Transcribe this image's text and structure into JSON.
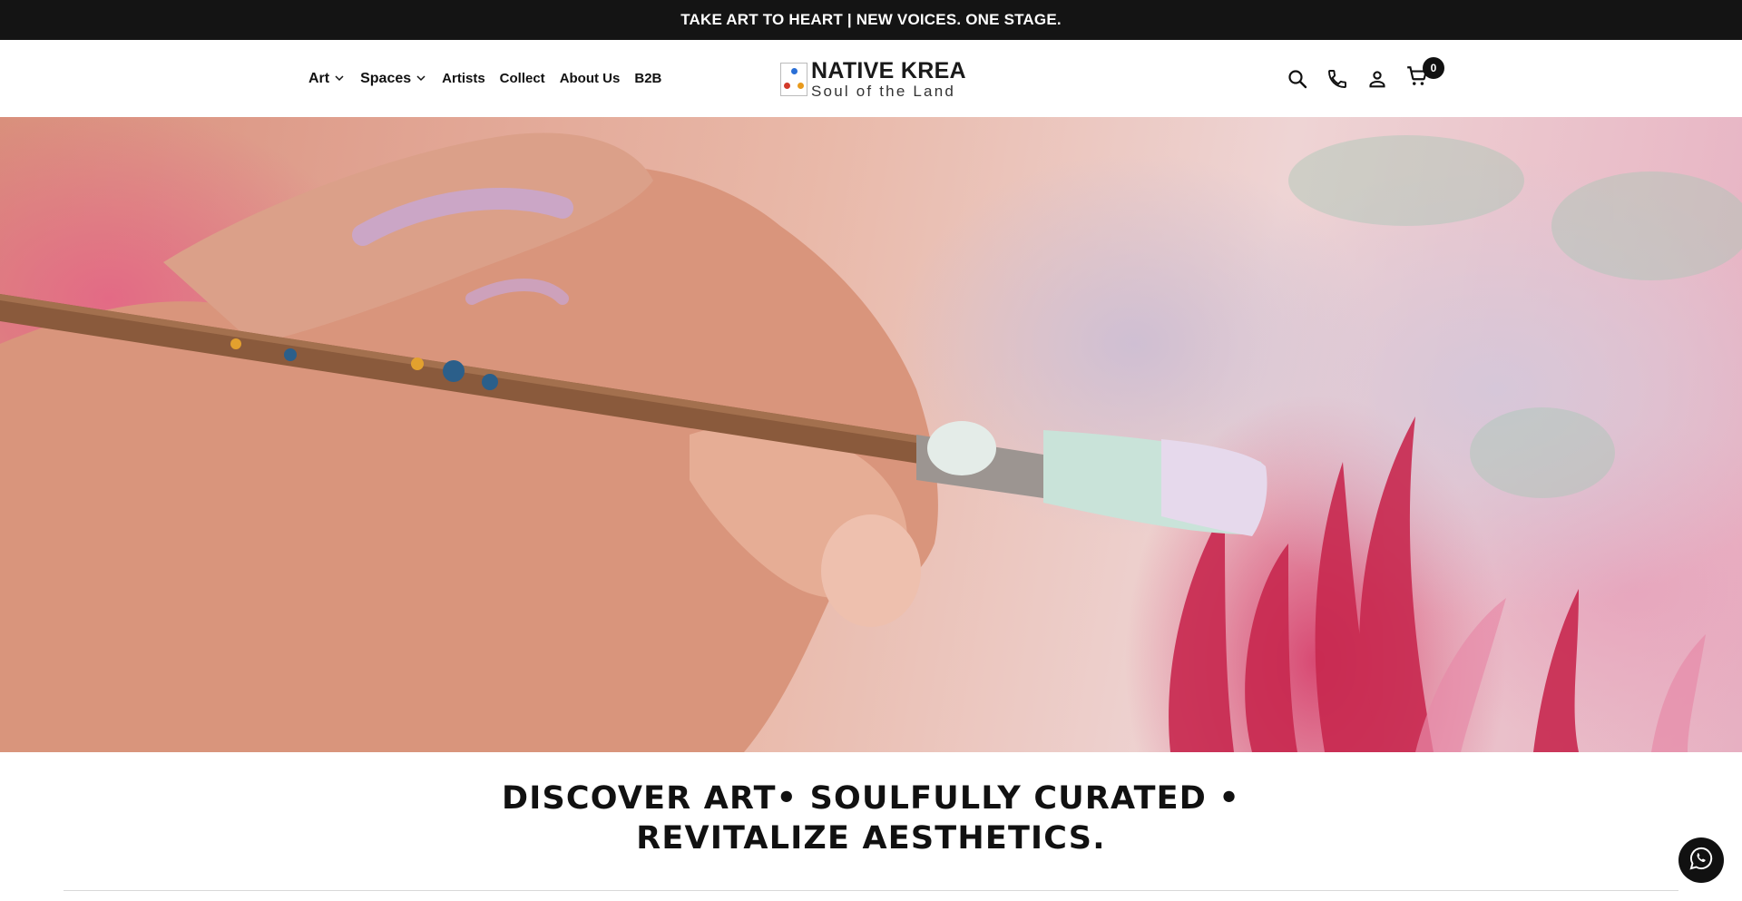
{
  "announcement": {
    "text": "TAKE ART TO HEART | NEW VOICES. ONE STAGE."
  },
  "nav": {
    "items": [
      {
        "label": "Art",
        "has_dropdown": true
      },
      {
        "label": "Spaces",
        "has_dropdown": true
      },
      {
        "label": "Artists",
        "has_dropdown": false
      },
      {
        "label": "Collect",
        "has_dropdown": false
      },
      {
        "label": "About Us",
        "has_dropdown": false
      },
      {
        "label": "B2B",
        "has_dropdown": false
      }
    ]
  },
  "logo": {
    "title": "NATIVE KREA",
    "subtitle": "Soul of the Land",
    "dot_colors": [
      "#2a6fd6",
      "#d23a2a",
      "#e89a1c"
    ]
  },
  "header_icons": [
    "search-icon",
    "phone-icon",
    "account-icon",
    "cart-icon"
  ],
  "cart": {
    "count": "0"
  },
  "hero": {
    "image": "hand-painting-with-brush"
  },
  "tagline": {
    "line1": "DISCOVER ART• SOULFULLY CURATED •",
    "line2": "REVITALIZE AESTHETICS."
  },
  "floating": {
    "icon": "whatsapp-icon"
  },
  "colors": {
    "announce_bg": "#141414",
    "text": "#111111",
    "badge_bg": "#111111"
  }
}
